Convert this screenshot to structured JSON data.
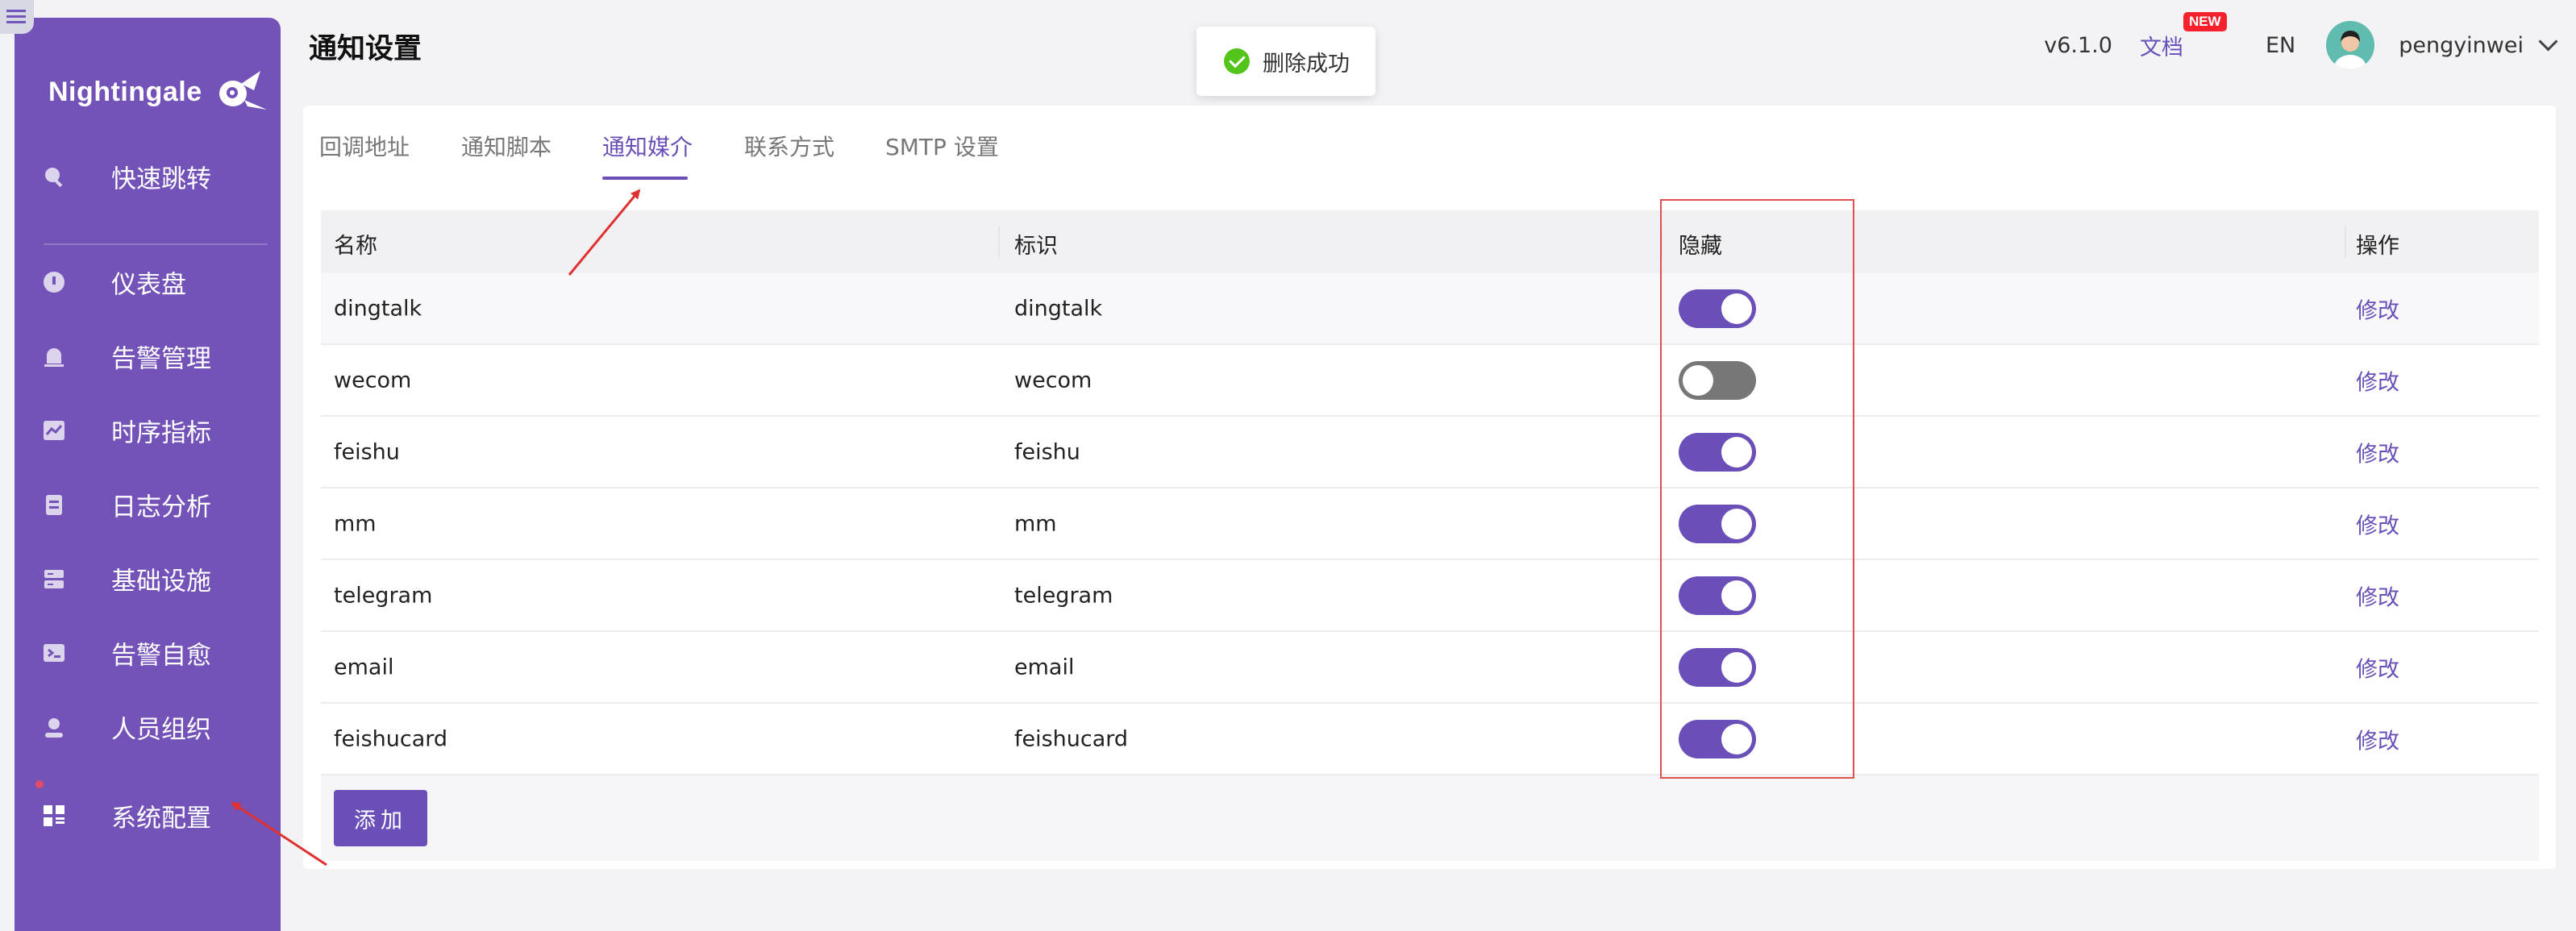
{
  "app": {
    "logo_text": "Nightingale",
    "page_title": "通知设置"
  },
  "sidebar": {
    "items": [
      {
        "label": "快速跳转",
        "icon": "search-icon"
      },
      {
        "label": "仪表盘",
        "icon": "dashboard-icon"
      },
      {
        "label": "告警管理",
        "icon": "alarm-bell-icon"
      },
      {
        "label": "时序指标",
        "icon": "line-chart-icon"
      },
      {
        "label": "日志分析",
        "icon": "log-document-icon"
      },
      {
        "label": "基础设施",
        "icon": "server-icon"
      },
      {
        "label": "告警自愈",
        "icon": "terminal-icon"
      },
      {
        "label": "人员组织",
        "icon": "user-icon"
      },
      {
        "label": "系统配置",
        "icon": "system-config-icon"
      }
    ],
    "active_index": 8
  },
  "header": {
    "version": "v6.1.0",
    "docs_label": "文档",
    "new_badge": "NEW",
    "lang": "EN",
    "username": "pengyinwei"
  },
  "toast": {
    "message": "删除成功",
    "icon": "check-circle-icon"
  },
  "tabs": [
    {
      "label": "回调地址"
    },
    {
      "label": "通知脚本"
    },
    {
      "label": "通知媒介",
      "active": true
    },
    {
      "label": "联系方式"
    },
    {
      "label": "SMTP 设置"
    }
  ],
  "table": {
    "columns": [
      "名称",
      "标识",
      "隐藏",
      "操作"
    ],
    "rows": [
      {
        "name": "dingtalk",
        "ident": "dingtalk",
        "hidden": true,
        "action": "修改"
      },
      {
        "name": "wecom",
        "ident": "wecom",
        "hidden": false,
        "action": "修改"
      },
      {
        "name": "feishu",
        "ident": "feishu",
        "hidden": true,
        "action": "修改"
      },
      {
        "name": "mm",
        "ident": "mm",
        "hidden": true,
        "action": "修改"
      },
      {
        "name": "telegram",
        "ident": "telegram",
        "hidden": true,
        "action": "修改"
      },
      {
        "name": "email",
        "ident": "email",
        "hidden": true,
        "action": "修改"
      },
      {
        "name": "feishucard",
        "ident": "feishucard",
        "hidden": true,
        "action": "修改"
      }
    ],
    "add_label": "添加"
  },
  "colors": {
    "brand": "#7353b8",
    "accent": "#6a4fb8",
    "success": "#52c41a",
    "annotation": "#e05050"
  }
}
